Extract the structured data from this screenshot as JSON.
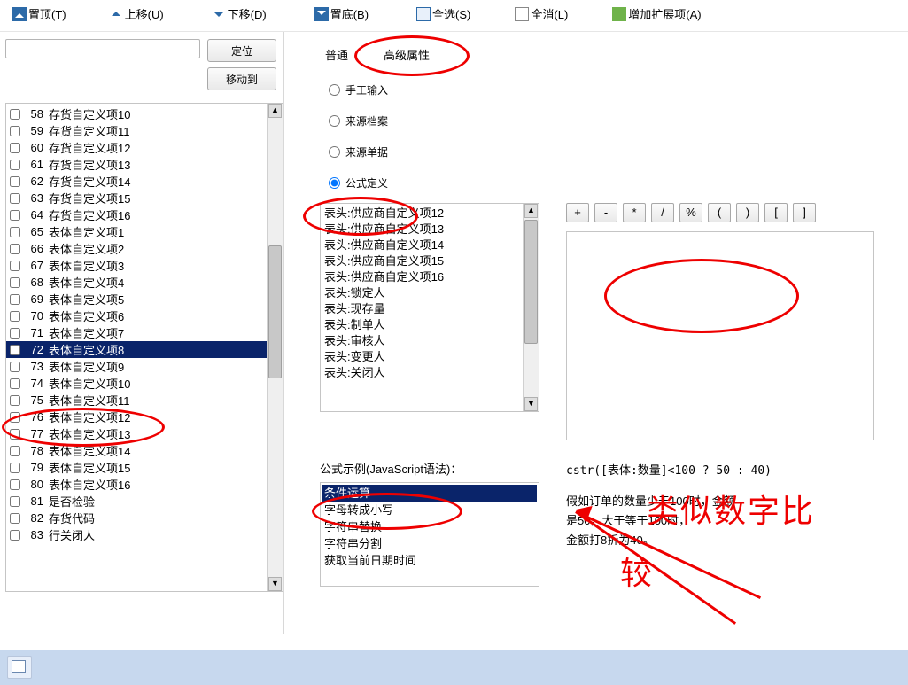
{
  "toolbar": {
    "top": "置顶(T)",
    "up": "上移(U)",
    "down": "下移(D)",
    "bottom": "置底(B)",
    "selall": "全选(S)",
    "desel": "全消(L)",
    "addext": "增加扩展项(A)"
  },
  "left": {
    "filter_placeholder": "",
    "locate_btn": "定位",
    "moveto_btn": "移动到",
    "rows": [
      {
        "n": "58",
        "t": "存货自定义项10"
      },
      {
        "n": "59",
        "t": "存货自定义项11"
      },
      {
        "n": "60",
        "t": "存货自定义项12"
      },
      {
        "n": "61",
        "t": "存货自定义项13"
      },
      {
        "n": "62",
        "t": "存货自定义项14"
      },
      {
        "n": "63",
        "t": "存货自定义项15"
      },
      {
        "n": "64",
        "t": "存货自定义项16"
      },
      {
        "n": "65",
        "t": "表体自定义项1"
      },
      {
        "n": "66",
        "t": "表体自定义项2"
      },
      {
        "n": "67",
        "t": "表体自定义项3"
      },
      {
        "n": "68",
        "t": "表体自定义项4"
      },
      {
        "n": "69",
        "t": "表体自定义项5"
      },
      {
        "n": "70",
        "t": "表体自定义项6"
      },
      {
        "n": "71",
        "t": "表体自定义项7"
      },
      {
        "n": "72",
        "t": "表体自定义项8",
        "sel": true
      },
      {
        "n": "73",
        "t": "表体自定义项9"
      },
      {
        "n": "74",
        "t": "表体自定义项10"
      },
      {
        "n": "75",
        "t": "表体自定义项11"
      },
      {
        "n": "76",
        "t": "表体自定义项12"
      },
      {
        "n": "77",
        "t": "表体自定义项13"
      },
      {
        "n": "78",
        "t": "表体自定义项14"
      },
      {
        "n": "79",
        "t": "表体自定义项15"
      },
      {
        "n": "80",
        "t": "表体自定义项16"
      },
      {
        "n": "81",
        "t": "是否检验"
      },
      {
        "n": "82",
        "t": "存货代码"
      },
      {
        "n": "83",
        "t": "行关闭人"
      }
    ]
  },
  "tabs": {
    "normal": "普通",
    "advanced": "高级属性"
  },
  "radios": {
    "manual": "手工输入",
    "srcfile": "来源档案",
    "srcdoc": "来源单据",
    "formula": "公式定义"
  },
  "fields": [
    "表头:供应商自定义项12",
    "表头:供应商自定义项13",
    "表头:供应商自定义项14",
    "表头:供应商自定义项15",
    "表头:供应商自定义项16",
    "表头:锁定人",
    "表头:现存量",
    "表头:制单人",
    "表头:审核人",
    "表头:变更人",
    "表头:关闭人"
  ],
  "ops": [
    "+",
    "-",
    "*",
    "/",
    "%",
    "(",
    ")",
    "[",
    "]"
  ],
  "examples": {
    "label": "公式示例(JavaScript语法)：",
    "items": [
      {
        "t": "条件运算",
        "sel": true
      },
      {
        "t": "字母转成小写"
      },
      {
        "t": "字符串替换"
      },
      {
        "t": "字符串分割"
      },
      {
        "t": "获取当前日期时间"
      }
    ],
    "code": "cstr([表体:数量]<100 ? 50 : 40)",
    "desc1": "假如订单的数量少于100时，金额",
    "desc2": "是50，大于等于100时，",
    "desc3": "金额打8折为40。"
  },
  "annotation": {
    "text1": "类似数字比",
    "text2": "较"
  }
}
